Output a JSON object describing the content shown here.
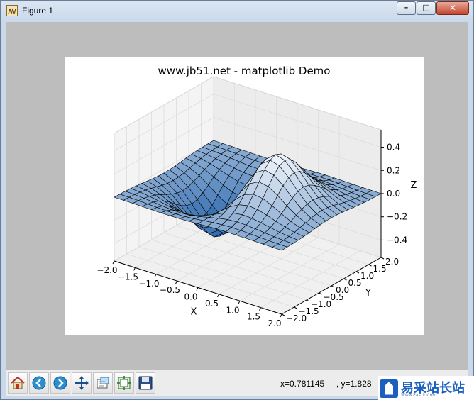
{
  "window": {
    "title": "Figure 1",
    "minimize_glyph": "–",
    "maximize_glyph": "□",
    "close_glyph": "✕"
  },
  "figure": {
    "title": "www.jb51.net - matplotlib Demo"
  },
  "chart_data": {
    "type": "surface3d",
    "title": "www.jb51.net - matplotlib Demo",
    "xlabel": "X",
    "ylabel": "Y",
    "zlabel": "Z",
    "xlim": [
      -2.0,
      2.0
    ],
    "ylim": [
      -2.0,
      2.0
    ],
    "zlim": [
      -0.5,
      0.5
    ],
    "x_ticks": [
      "−2.0",
      "−1.5",
      "−1.0",
      "−0.5",
      "0.0",
      "0.5",
      "1.0",
      "1.5",
      "2.0"
    ],
    "y_ticks": [
      "−2.0",
      "−1.5",
      "−1.0",
      "−0.5",
      "0.0",
      "0.5",
      "1.0",
      "1.5",
      "2.0"
    ],
    "z_ticks": [
      "−0.4",
      "−0.2",
      "0.0",
      "0.2",
      "0.4"
    ],
    "surface": "z = x * exp(-x^2 - y^2)",
    "colormap": "Blues",
    "grid": true,
    "colors": {
      "surface_low": "#1f5fa8",
      "surface_high": "#f1f6fc",
      "edge": "#000000"
    }
  },
  "toolbar": {
    "buttons": [
      {
        "name": "home-button",
        "icon": "home-icon"
      },
      {
        "name": "back-button",
        "icon": "back-arrow-icon"
      },
      {
        "name": "forward-button",
        "icon": "forward-arrow-icon"
      },
      {
        "name": "pan-button",
        "icon": "move-cross-icon"
      },
      {
        "name": "zoom-button",
        "icon": "zoom-rect-icon"
      },
      {
        "name": "subplots-button",
        "icon": "subplots-config-icon"
      },
      {
        "name": "save-button",
        "icon": "floppy-disk-icon"
      }
    ],
    "coords_text": "x=0.781145     , y=1.828"
  },
  "watermark": {
    "text": "易采站长站",
    "subtext": "Www.Easck.Com"
  }
}
